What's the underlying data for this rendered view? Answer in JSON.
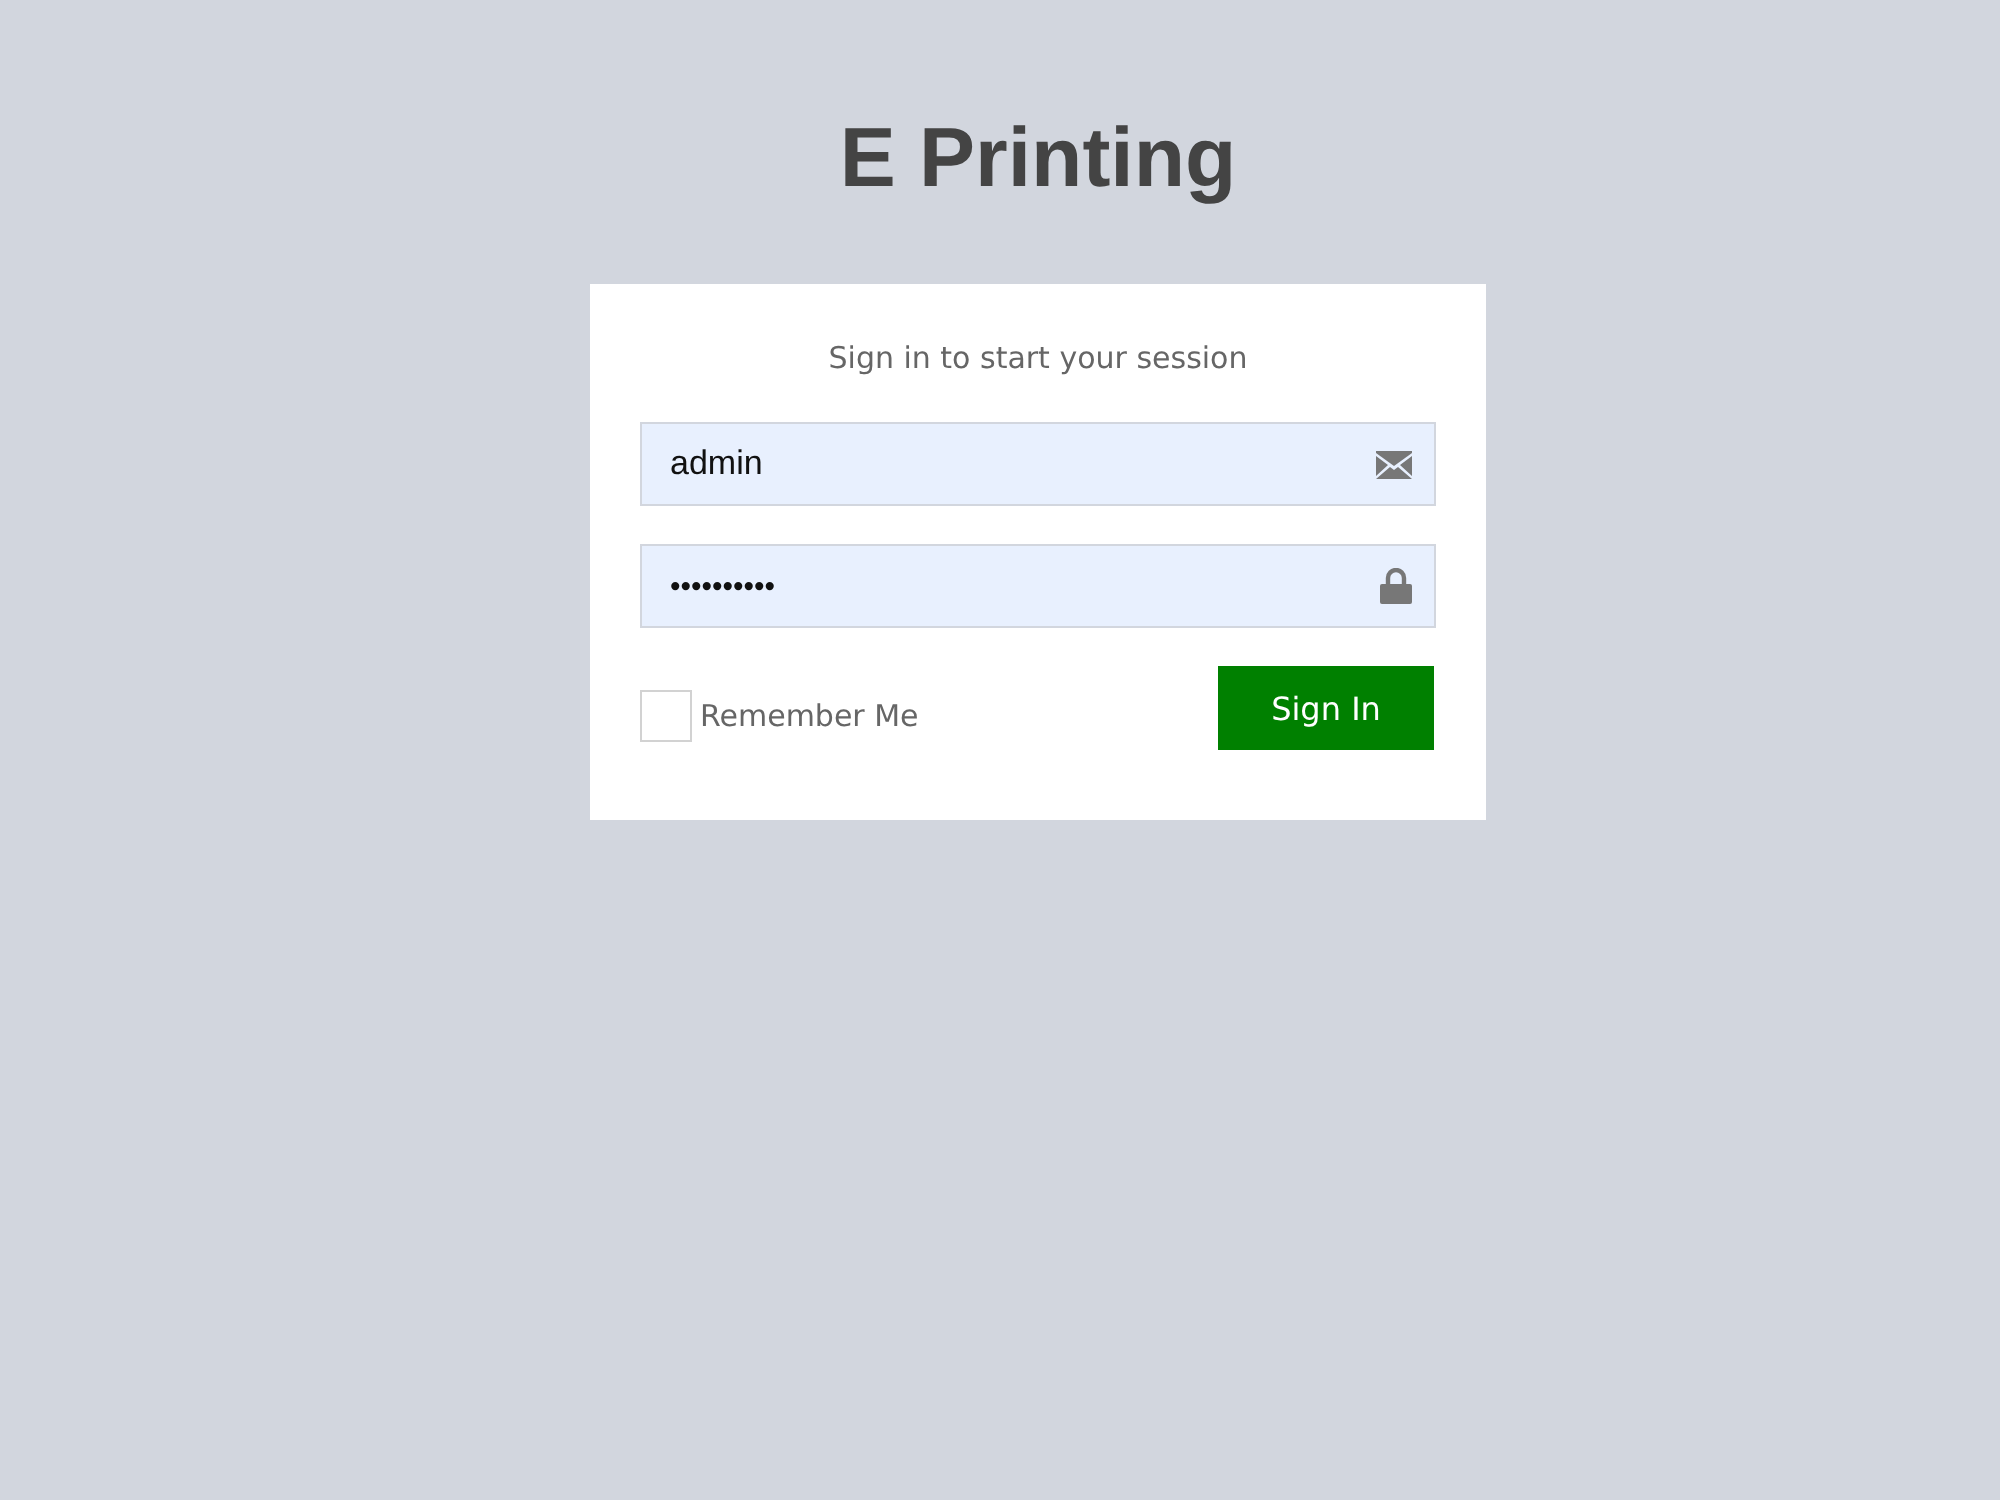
{
  "title": "E Printing",
  "card": {
    "subtitle": "Sign in to start your session",
    "fields": [
      {
        "kind": "email",
        "value": "admin"
      },
      {
        "kind": "password",
        "value": "••••••••••"
      }
    ],
    "remember": {
      "label": "Remember Me",
      "checked": false
    },
    "submit": "Sign In"
  }
}
